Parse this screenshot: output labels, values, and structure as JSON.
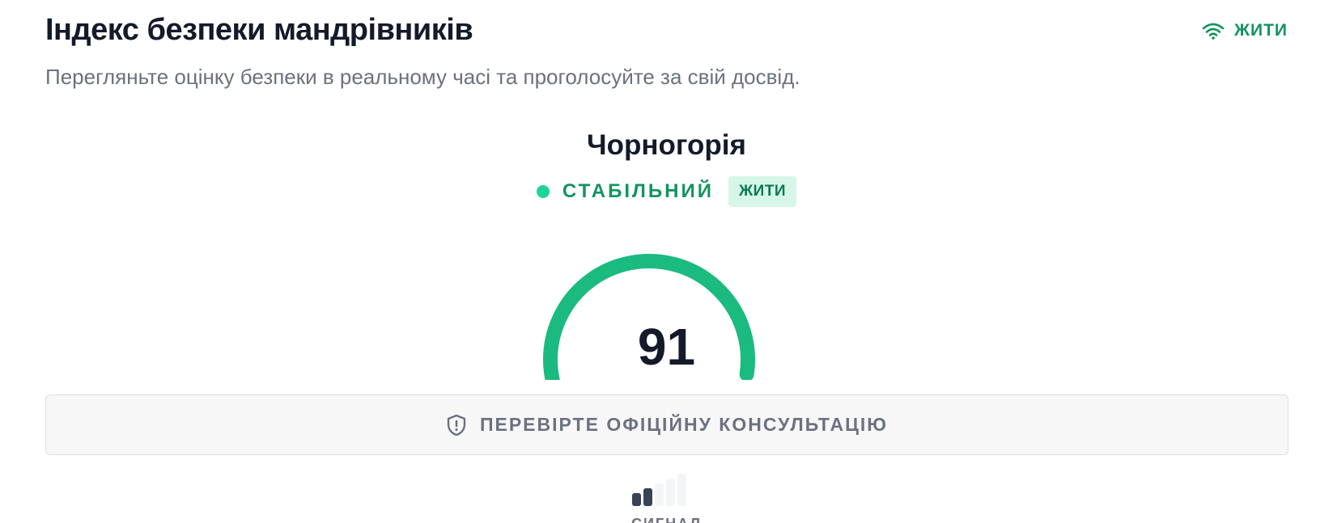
{
  "header": {
    "title": "Індекс безпеки мандрівників",
    "subtitle": "Перегляньте оцінку безпеки в реальному часі та проголосуйте за свій досвід.",
    "live_label": "ЖИТИ"
  },
  "destination": {
    "country": "Чорногорія",
    "status": "СТАБІЛЬНИЙ",
    "live_badge": "ЖИТИ"
  },
  "gauge": {
    "score": "91",
    "value": 91,
    "max": 100
  },
  "advisory": {
    "label": "ПЕРЕВІРТЕ ОФІЦІЙНУ КОНСУЛЬТАЦІЮ",
    "icon": "shield-alert-icon"
  },
  "signal": {
    "label": "СИГНАЛ",
    "bars_active": 2,
    "bars_total": 5
  },
  "colors": {
    "accent": "#1bbb7f",
    "live_text": "#12945f",
    "status_dot": "#1ed39a",
    "badge_bg": "#d6f7e8",
    "muted_text": "#6b7180",
    "dark_text": "#141a2a"
  }
}
